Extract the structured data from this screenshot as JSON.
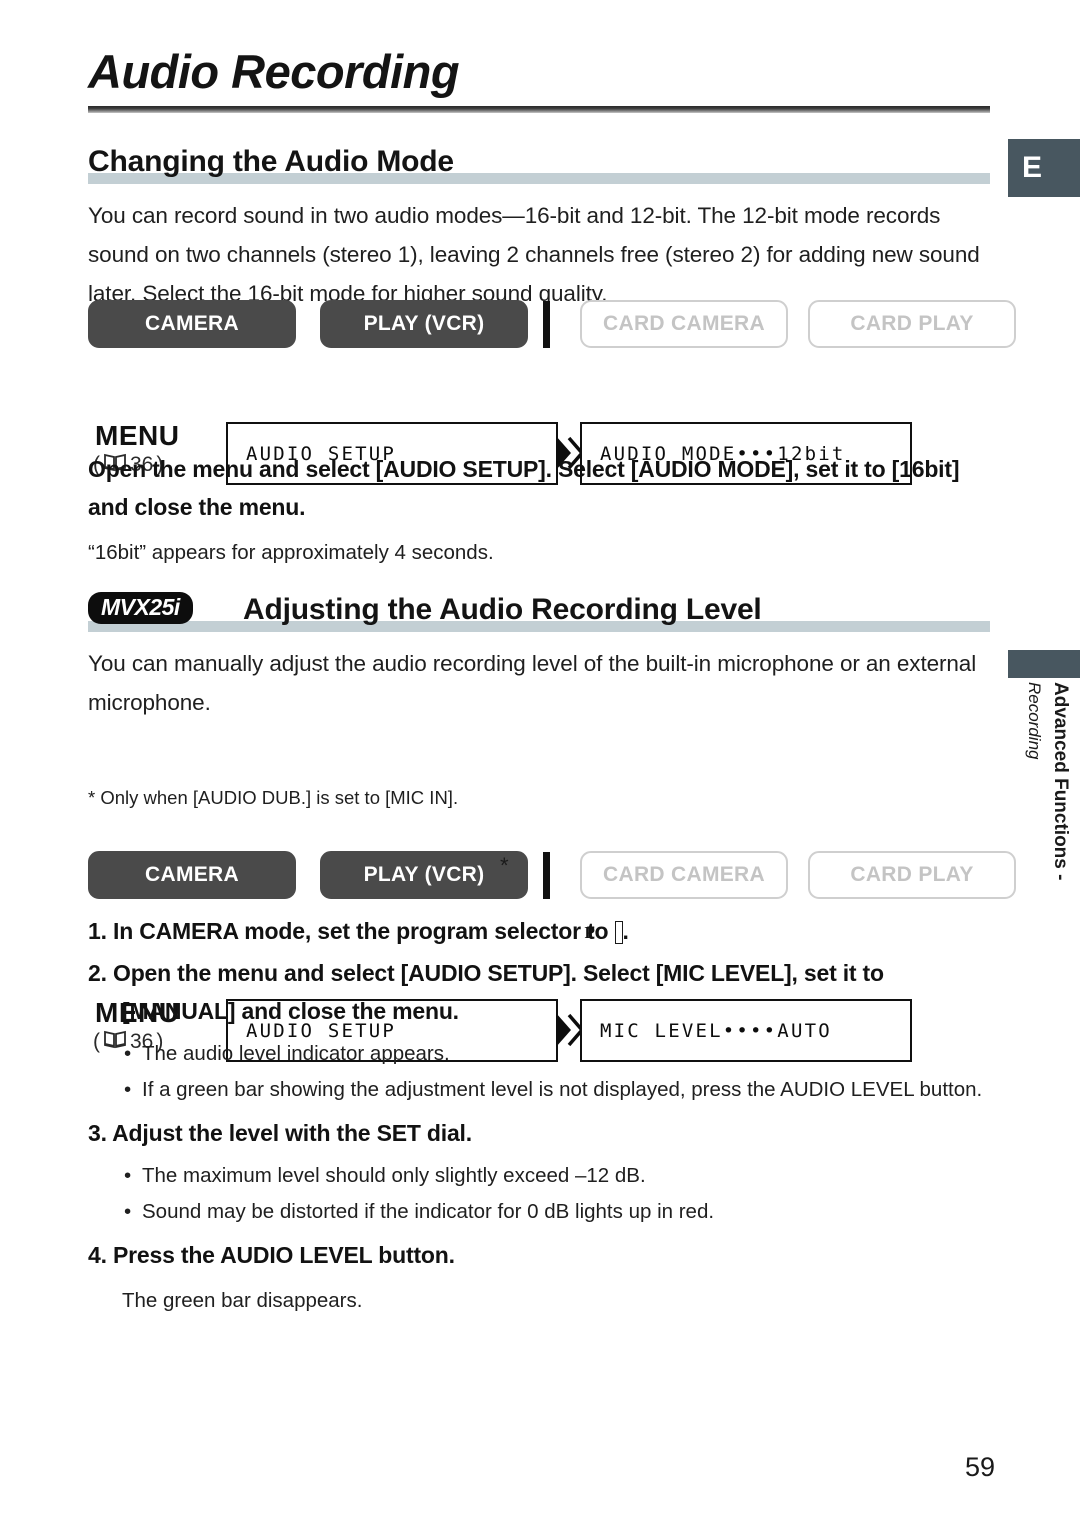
{
  "page": {
    "title": "Audio Recording",
    "number": "59",
    "edge_tab_letter": "E",
    "side_tab_main": "Advanced Functions -",
    "side_tab_sub": "Recording"
  },
  "sections": [
    {
      "heading": "Changing the Audio Mode",
      "intro": "You can record sound in two audio modes—16-bit and 12-bit. The 12-bit mode records sound on two channels (stereo 1), leaving 2 channels free (stereo 2) for adding new sound later. Select the 16-bit mode for higher sound quality.",
      "modes": [
        {
          "label": "CAMERA",
          "state": "on"
        },
        {
          "label": "PLAY (VCR)",
          "state": "on"
        },
        {
          "label": "CARD CAMERA",
          "state": "off"
        },
        {
          "label": "CARD PLAY",
          "state": "off"
        }
      ],
      "menu": {
        "label": "MENU",
        "ref_open": "(",
        "ref_page": "36",
        "ref_close": ")",
        "box_a": "AUDIO SETUP",
        "box_b": "AUDIO MODE•••12bit"
      },
      "instruction": "Open the menu and select [AUDIO SETUP]. Select [AUDIO MODE], set it to [16bit] and close the menu.",
      "note": "“16bit” appears for approximately 4 seconds."
    },
    {
      "badge": "MVX25i",
      "heading": "Adjusting the Audio Recording Level",
      "intro": "You can manually adjust the audio recording level of the built-in microphone or an external microphone.",
      "modes": [
        {
          "label": "CAMERA",
          "state": "on"
        },
        {
          "label": "PLAY (VCR)",
          "state": "on",
          "superscript": "*"
        },
        {
          "label": "CARD CAMERA",
          "state": "off"
        },
        {
          "label": "CARD PLAY",
          "state": "off"
        }
      ],
      "footnote": "* Only when [AUDIO DUB.] is set to [MIC IN].",
      "menu": {
        "label": "MENU",
        "ref_open": "(",
        "ref_page": "36",
        "ref_close": ")",
        "box_a": "AUDIO SETUP",
        "box_b": "MIC LEVEL••••AUTO"
      },
      "steps": [
        {
          "num": "1.",
          "text_before": "In CAMERA mode, set the program selector to ",
          "symbol": "P",
          "text_after": "."
        },
        {
          "num": "2.",
          "text_before": "Open the menu and select [AUDIO SETUP]. Select [MIC LEVEL], set it to [MANUAL] and close the menu.",
          "symbol": "",
          "text_after": ""
        },
        {
          "num": "3.",
          "text_before": "Adjust the level with the SET dial.",
          "symbol": "",
          "text_after": ""
        },
        {
          "num": "4.",
          "text_before": "Press the AUDIO LEVEL button.",
          "symbol": "",
          "text_after": ""
        }
      ],
      "bullets_step2": [
        "The audio level indicator appears.",
        "If a green bar showing the adjustment level is not displayed, press the AUDIO LEVEL button."
      ],
      "bullets_step3": [
        "The maximum level should only slightly exceed –12 dB.",
        "Sound may be distorted if the indicator for 0 dB lights up in red."
      ],
      "note_step4": "The green bar disappears."
    }
  ],
  "colors": {
    "accent_bar": "#c3cfd4",
    "tab": "#485760",
    "button_on": "#4a4a4a",
    "button_off_border": "#cfcfcf"
  }
}
